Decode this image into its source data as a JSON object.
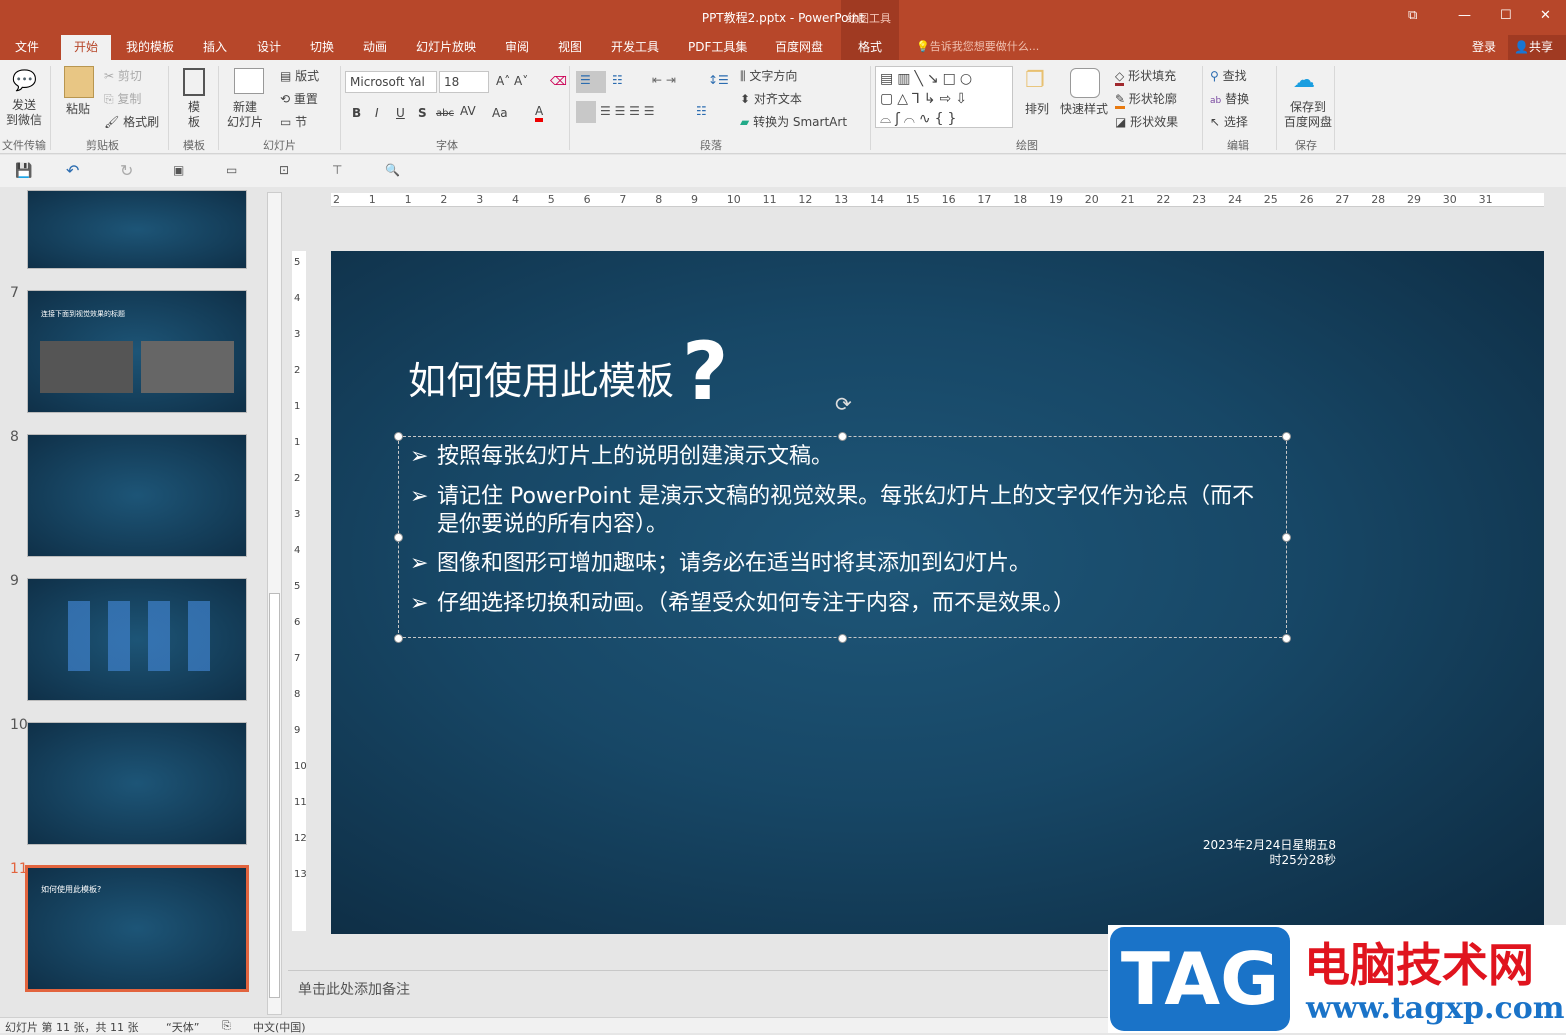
{
  "window": {
    "title": "PPT教程2.pptx - PowerPoint",
    "context_tool": "绘图工具",
    "restore": "⧉",
    "minimize": "—",
    "maximize": "☐",
    "close": "✕"
  },
  "tabs": [
    "文件",
    "开始",
    "我的模板",
    "插入",
    "设计",
    "切换",
    "动画",
    "幻灯片放映",
    "审阅",
    "视图",
    "开发工具",
    "PDF工具集",
    "百度网盘",
    "格式"
  ],
  "tell_me": "告诉我您想要做什么...",
  "login": "登录",
  "share": "共享",
  "ribbon": {
    "send_wechat": "发送\n到微信",
    "group_file": "文件传输",
    "paste": "粘贴",
    "cut": "剪切",
    "copy": "复制",
    "format_painter": "格式刷",
    "group_clipboard": "剪贴板",
    "template": "模\n板",
    "group_template": "模板",
    "new_slide": "新建\n幻灯片",
    "layout": "版式",
    "reset": "重置",
    "section": "节",
    "group_slides": "幻灯片",
    "font_name": "Microsoft Yal",
    "font_size": "18",
    "group_font": "字体",
    "font_buttons": [
      "B",
      "I",
      "U",
      "S",
      "abc",
      "AV",
      "Aa",
      "A"
    ],
    "text_direction": "文字方向",
    "align_text": "对齐文本",
    "smartart": "转换为 SmartArt",
    "group_paragraph": "段落",
    "arrange": "排列",
    "quick_styles": "快速样式",
    "shape_fill": "形状填充",
    "shape_outline": "形状轮廓",
    "shape_effects": "形状效果",
    "group_drawing": "绘图",
    "find": "查找",
    "replace": "替换",
    "select": "选择",
    "group_editing": "编辑",
    "save_baidu": "保存到\n百度网盘",
    "group_save": "保存"
  },
  "ruler": {
    "h": [
      "2",
      "1",
      "1",
      "2",
      "3",
      "4",
      "5",
      "6",
      "7",
      "8",
      "9",
      "10",
      "11",
      "12",
      "13",
      "14",
      "15",
      "16",
      "17",
      "18",
      "19",
      "20",
      "21",
      "22",
      "23",
      "24",
      "25",
      "26",
      "27",
      "28",
      "29",
      "30",
      "31"
    ],
    "v": [
      "5",
      "4",
      "3",
      "2",
      "1",
      "1",
      "2",
      "3",
      "4",
      "5",
      "6",
      "7",
      "8",
      "9",
      "10",
      "11",
      "12",
      "13"
    ]
  },
  "thumbnails": [
    {
      "num": ""
    },
    {
      "num": "7",
      "title": "连接下面到视觉效果的标题"
    },
    {
      "num": "8"
    },
    {
      "num": "9"
    },
    {
      "num": "10"
    },
    {
      "num": "11",
      "title": "如何使用此模板?",
      "selected": true
    }
  ],
  "slide": {
    "title": "如何使用此模板",
    "qmark": "?",
    "bullets": [
      "按照每张幻灯片上的说明创建演示文稿。",
      "请记住 PowerPoint 是演示文稿的视觉效果。每张幻灯片上的文字仅作为论点（而不是你要说的所有内容）。",
      "图像和图形可增加趣味；请务必在适当时将其添加到幻灯片。",
      "仔细选择切换和动画。（希望受众如何专注于内容，而不是效果。）"
    ],
    "bullet_glyph": "➢",
    "date_line1": "2023年2月24日星期五8",
    "date_line2": "时25分28秒"
  },
  "notes_placeholder": "单击此处添加备注",
  "status": {
    "slide": "幻灯片 第 11 张，共 11 张",
    "theme": "“天体”",
    "lang": "中文(中国)"
  },
  "watermark": {
    "tag": "TAG",
    "site_cn": "电脑技术网",
    "url": "www.tagxp.com"
  },
  "colors": {
    "accent": "#b7472a",
    "slide_bg": "#174766",
    "selected_thumb": "#e2643e"
  }
}
